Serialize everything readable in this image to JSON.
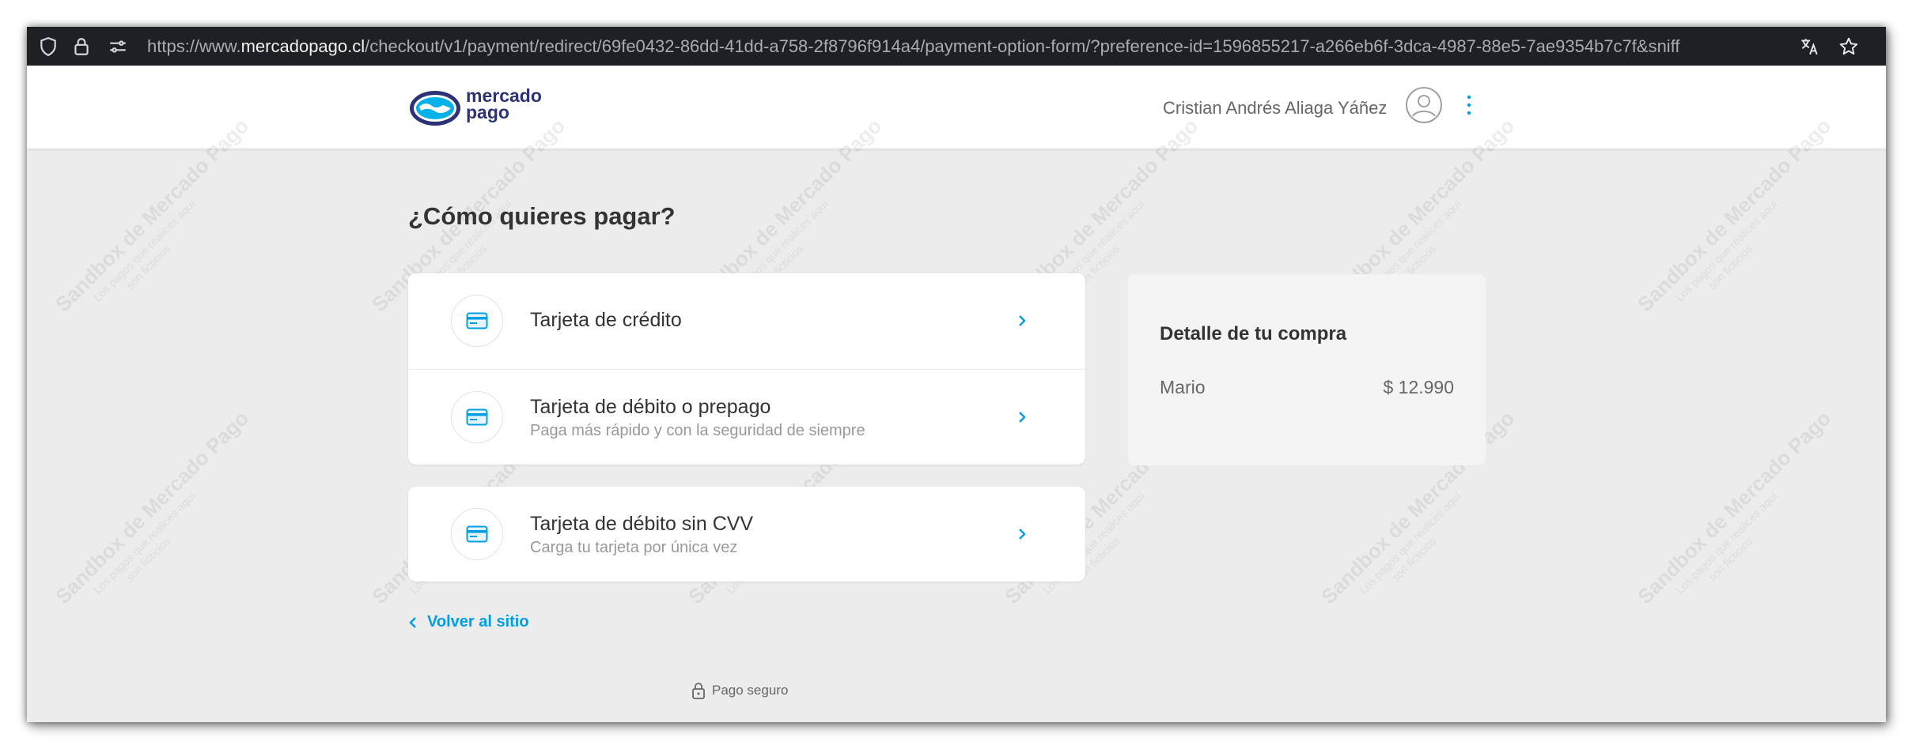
{
  "browser": {
    "url_prefix": "https://www.",
    "url_domain": "mercadopago.cl",
    "url_rest": "/checkout/v1/payment/redirect/69fe0432-86dd-41dd-a758-2f8796f914a4/payment-option-form/?preference-id=1596855217-a266eb6f-3dca-4987-88e5-7ae9354b7c7f&sniff"
  },
  "header": {
    "logo_line1": "mercado",
    "logo_line2": "pago",
    "user_name": "Cristian Andrés Aliaga Yáñez"
  },
  "watermark": {
    "line1": "Sandbox de Mercado Pago",
    "line2": "Los pagos que realices aquí",
    "line3": "son ficticios"
  },
  "main": {
    "title": "¿Cómo quieres pagar?",
    "options": [
      {
        "title": "Tarjeta de crédito",
        "subtitle": ""
      },
      {
        "title": "Tarjeta de débito o prepago",
        "subtitle": "Paga más rápido y con la seguridad de siempre"
      },
      {
        "title": "Tarjeta de débito sin CVV",
        "subtitle": "Carga tu tarjeta por única vez"
      }
    ],
    "back_label": "Volver al sitio",
    "secure_label": "Pago seguro"
  },
  "summary": {
    "title": "Detalle de tu compra",
    "item_name": "Mario",
    "item_price": "$ 12.990"
  },
  "colors": {
    "accent": "#009ee3",
    "background": "#ececec",
    "urlbar": "#1f2023",
    "brand": "#2d3277"
  },
  "icons": [
    "shield-icon",
    "lock-icon",
    "site-settings-icon",
    "translate-icon",
    "star-icon",
    "user-icon",
    "kebab-menu-icon",
    "card-icon",
    "chevron-right-icon",
    "chevron-left-icon",
    "padlock-icon"
  ]
}
